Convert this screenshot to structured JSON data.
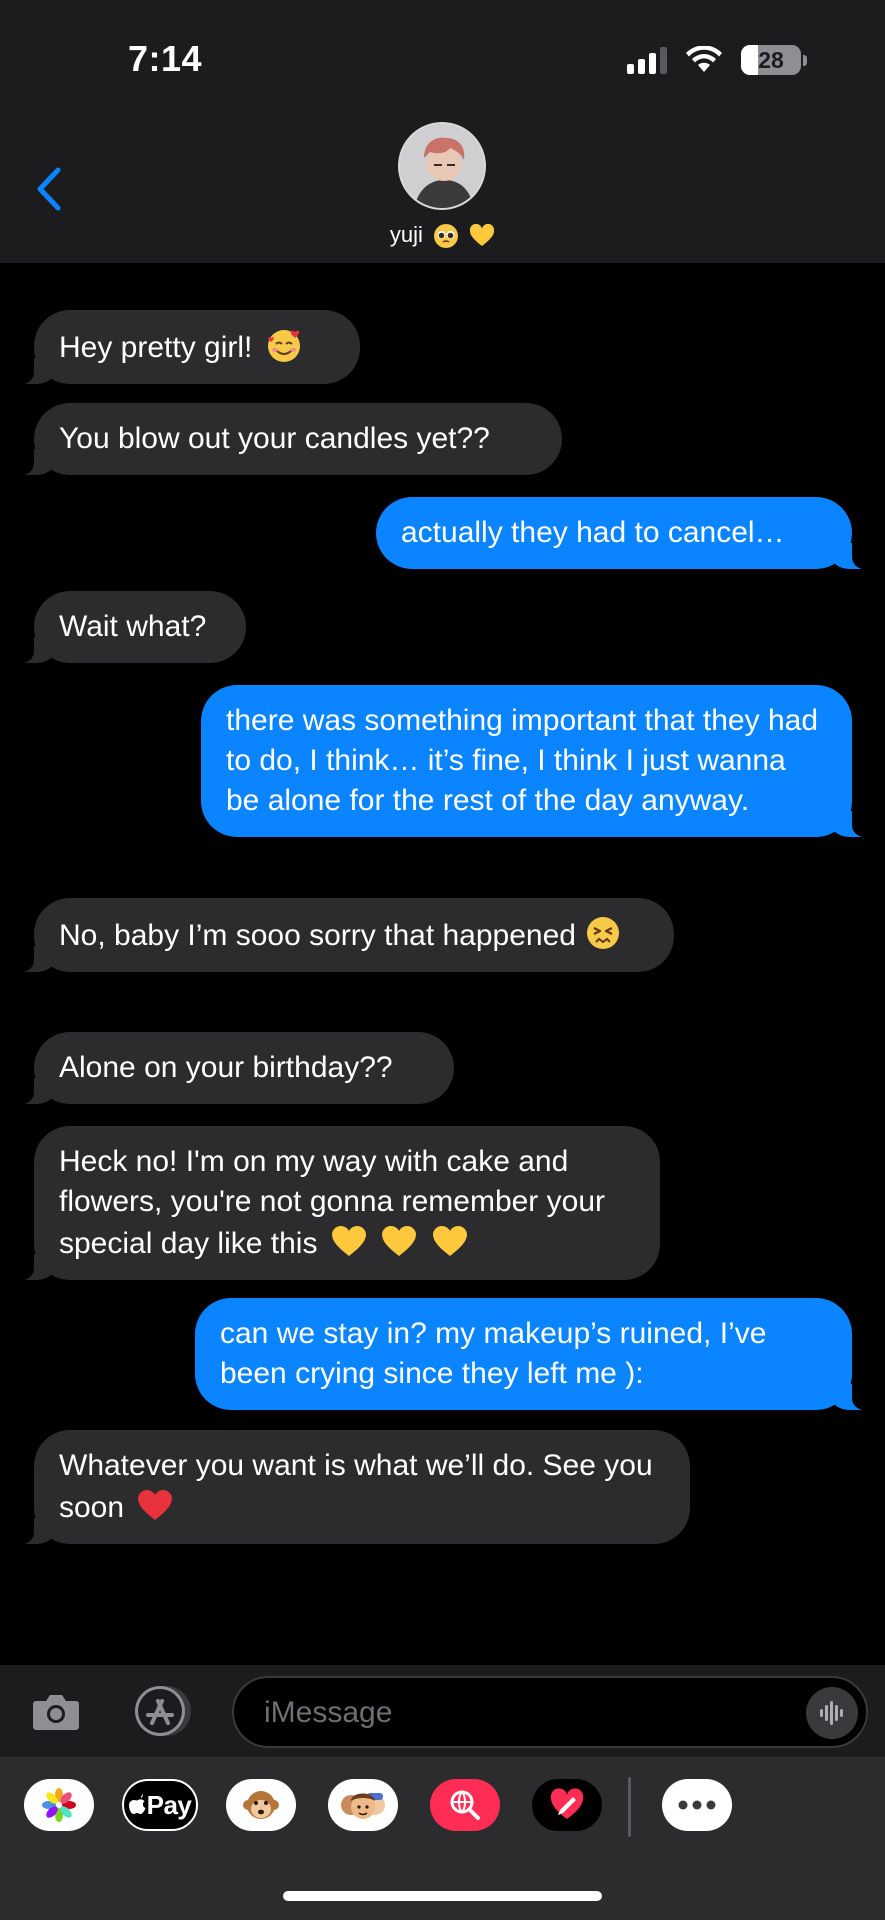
{
  "status_bar": {
    "time": "7:14",
    "battery": "28",
    "battery_level": 0.28
  },
  "header": {
    "contact_name": "yuji",
    "back_icon": "chevron-left-icon",
    "accent_color": "#0a84ff"
  },
  "messages": [
    {
      "dir": "in",
      "text": "Hey pretty girl!",
      "emoji": "smiling-face-with-hearts"
    },
    {
      "dir": "in",
      "text": "You blow out your candles yet??"
    },
    {
      "dir": "out",
      "text": "actually they had to cancel…"
    },
    {
      "dir": "in",
      "text": "Wait what?"
    },
    {
      "dir": "out",
      "text": "there was something important that they had to do, I think… it’s fine, I think I just wanna be alone for the rest of the day anyway."
    },
    {
      "dir": "in",
      "text": "No, baby I’m sooo sorry that happened",
      "emoji": "persevering-face"
    },
    {
      "dir": "in",
      "text": "Alone on your birthday??"
    },
    {
      "dir": "in",
      "text": "Heck no! I'm on my way with cake and flowers, you're not gonna remember your special day like this",
      "emoji": "yellow-heart x3"
    },
    {
      "dir": "out",
      "text": "can we stay in? my makeup’s ruined, I’ve been crying since they left me ):"
    },
    {
      "dir": "in",
      "text": "Whatever you want is what we’ll do. See you soon",
      "emoji": "red-heart"
    }
  ],
  "input": {
    "placeholder": "iMessage"
  },
  "app_drawer": {
    "apple_pay_label": "Pay"
  },
  "colors": {
    "incoming": "#2c2c2e",
    "outgoing": "#0a84ff",
    "background": "#000000"
  }
}
